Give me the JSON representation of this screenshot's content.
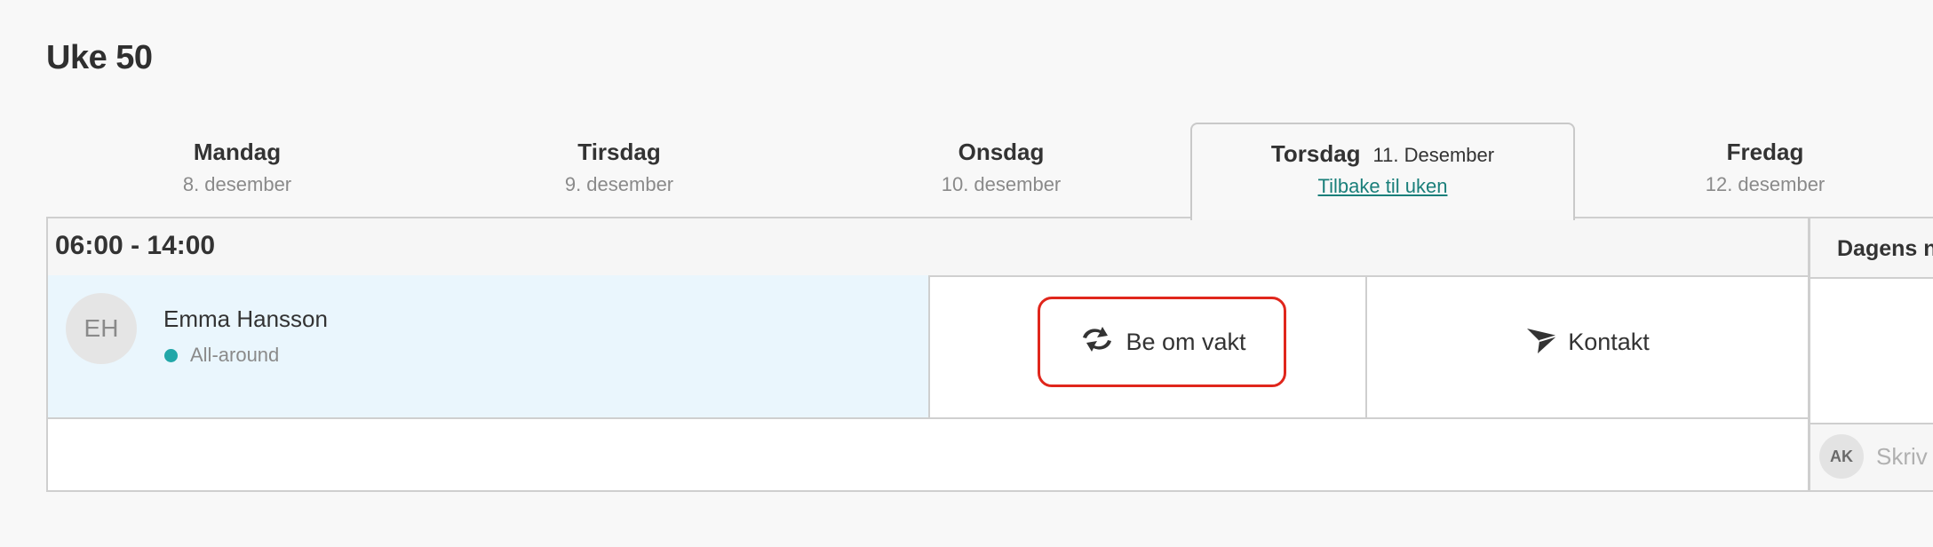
{
  "week": {
    "title": "Uke 50"
  },
  "days": [
    {
      "name": "Mandag",
      "date": "8. desember"
    },
    {
      "name": "Tirsdag",
      "date": "9. desember"
    },
    {
      "name": "Onsdag",
      "date": "10. desember"
    },
    {
      "name": "Torsdag",
      "long_date": "11. Desember",
      "back_link": "Tilbake til uken",
      "active": true
    },
    {
      "name": "Fredag",
      "date": "12. desember"
    }
  ],
  "shift": {
    "time": "06:00 - 14:00",
    "employee": {
      "initials": "EH",
      "name": "Emma Hansson",
      "role": "All-around",
      "role_color": "#22a7a8"
    },
    "actions": {
      "request_label": "Be om vakt",
      "contact_label": "Kontakt"
    }
  },
  "notes": {
    "title": "Dagens n",
    "avatar_initials": "AK",
    "input_placeholder": "Skriv"
  },
  "colors": {
    "accent_link": "#1a7f7a",
    "highlight_border": "#e0261c",
    "employee_bg": "#eaf6fd"
  }
}
